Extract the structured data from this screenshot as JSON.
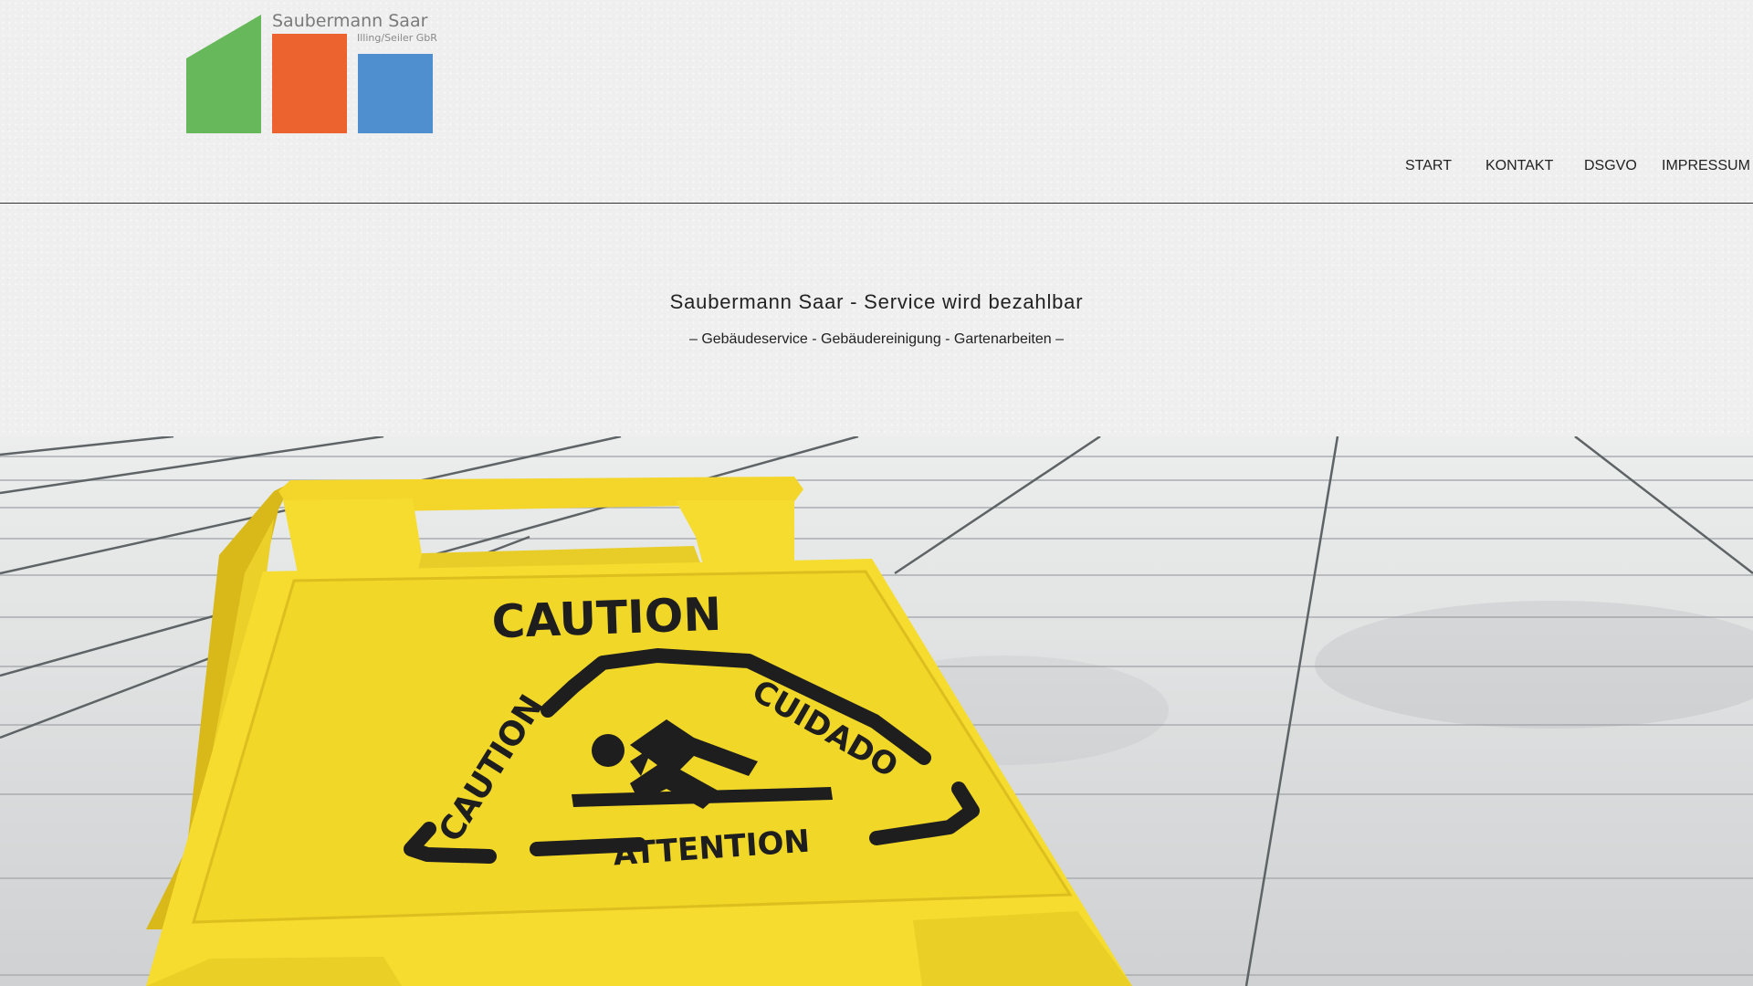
{
  "logo": {
    "name": "Saubermann Saar",
    "subtitle": "Illing/Seiler GbR",
    "colors": {
      "green": "#67b85a",
      "orange": "#ec6330",
      "blue": "#4f8fcf"
    }
  },
  "nav": {
    "items": [
      {
        "label": "START"
      },
      {
        "label": "KONTAKT"
      },
      {
        "label": "DSGVO"
      },
      {
        "label": "IMPRESSUM"
      }
    ]
  },
  "hero": {
    "title": "Saubermann Saar - Service wird bezahlbar",
    "subtitle": "– Gebäudeservice - Gebäudereinigung - Gartenarbeiten –"
  },
  "banner": {
    "sign_heading": "CAUTION",
    "sign_left": "CAUTION",
    "sign_right": "CUIDADO",
    "sign_bottom": "ATTENTION",
    "sign_color": "#f5dc2e"
  }
}
